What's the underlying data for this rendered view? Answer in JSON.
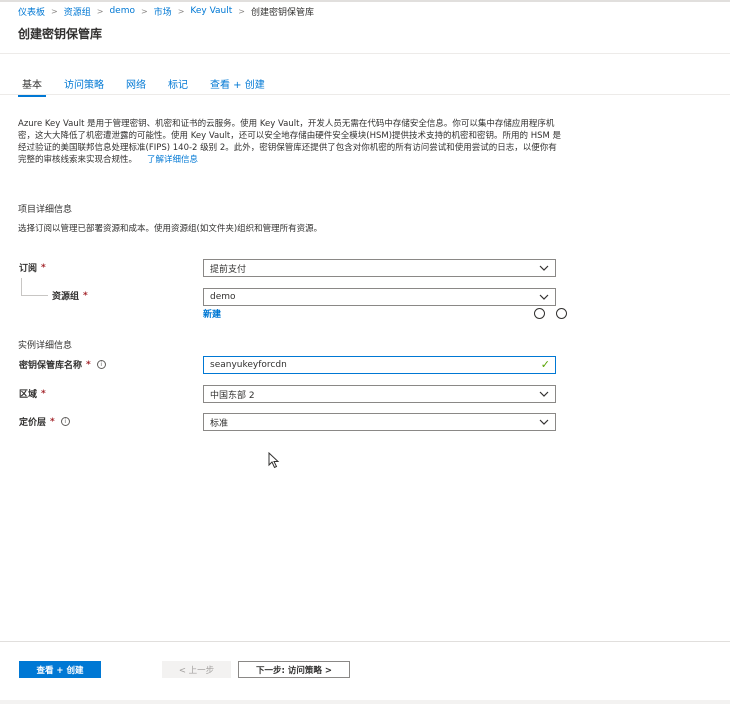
{
  "breadcrumb": {
    "items": [
      "仪表板",
      "资源组",
      "demo",
      "市场",
      "Key Vault"
    ],
    "current": "创建密钥保管库"
  },
  "page": {
    "title": "创建密钥保管库"
  },
  "tabs": [
    "基本",
    "访问策略",
    "网络",
    "标记",
    "查看 + 创建"
  ],
  "description": {
    "text": "Azure Key Vault 是用于管理密钥、机密和证书的云服务。使用 Key Vault，开发人员无需在代码中存储安全信息。你可以集中存储应用程序机密，这大大降低了机密遭泄露的可能性。使用 Key Vault，还可以安全地存储由硬件安全模块(HSM)提供技术支持的机密和密钥。所用的 HSM 是经过验证的美国联邦信息处理标准(FIPS) 140-2 级别 2。此外，密钥保管库还提供了包含对你机密的所有访问尝试和使用尝试的日志，以便你有完整的审核线索来实现合规性。",
    "link": "了解详细信息"
  },
  "project": {
    "title": "项目详细信息",
    "desc": "选择订阅以管理已部署资源和成本。使用资源组(如文件夹)组织和管理所有资源。",
    "subscription_label": "订阅",
    "subscription_value": "提前支付",
    "resource_group_label": "资源组",
    "resource_group_value": "demo",
    "new_link": "新建"
  },
  "instance": {
    "title": "实例详细信息",
    "name_label": "密钥保管库名称",
    "name_value": "seanyukeyforcdn",
    "region_label": "区域",
    "region_value": "中国东部 2",
    "tier_label": "定价层",
    "tier_value": "标准"
  },
  "required_mark": "*",
  "footer": {
    "review_create": "查看 + 创建",
    "prev": "< 上一步",
    "next": "下一步: 访问策略 >"
  },
  "colors": {
    "accent": "#0078d4",
    "required": "#a4262c",
    "valid": "#57a300"
  }
}
